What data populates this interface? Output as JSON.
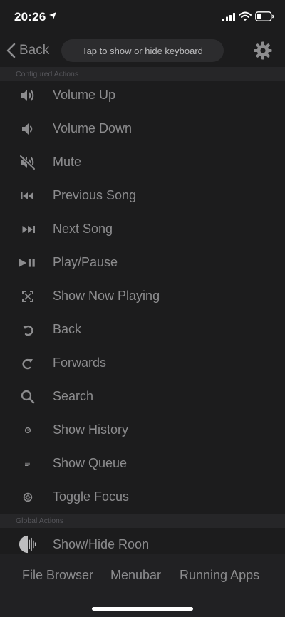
{
  "status_bar": {
    "time": "20:26"
  },
  "nav": {
    "back_label": "Back",
    "keyboard_toggle_label": "Tap to show or hide keyboard"
  },
  "sections": {
    "configured_title": "Configured Actions",
    "global_title": "Global Actions"
  },
  "configured_actions": [
    {
      "label": "Volume Up",
      "icon": "volume-up-icon"
    },
    {
      "label": "Volume Down",
      "icon": "volume-down-icon"
    },
    {
      "label": "Mute",
      "icon": "mute-icon"
    },
    {
      "label": "Previous Song",
      "icon": "previous-icon"
    },
    {
      "label": "Next Song",
      "icon": "next-icon"
    },
    {
      "label": "Play/Pause",
      "icon": "play-pause-icon"
    },
    {
      "label": "Show Now Playing",
      "icon": "now-playing-icon"
    },
    {
      "label": "Back",
      "icon": "back-arrow-icon"
    },
    {
      "label": "Forwards",
      "icon": "forward-arrow-icon"
    },
    {
      "label": "Search",
      "icon": "search-icon"
    },
    {
      "label": "Show History",
      "icon": "history-icon"
    },
    {
      "label": "Show Queue",
      "icon": "queue-icon"
    },
    {
      "label": "Toggle Focus",
      "icon": "focus-icon"
    }
  ],
  "global_actions": [
    {
      "label": "Show/Hide Roon",
      "icon": "roon-icon"
    }
  ],
  "tabs": [
    {
      "label": "File Browser"
    },
    {
      "label": "Menubar"
    },
    {
      "label": "Running Apps"
    }
  ],
  "colors": {
    "background": "#1c1c1d",
    "text": "#8c8c8e",
    "section_header_bg": "#262628",
    "pill_bg": "#2c2c2e"
  }
}
